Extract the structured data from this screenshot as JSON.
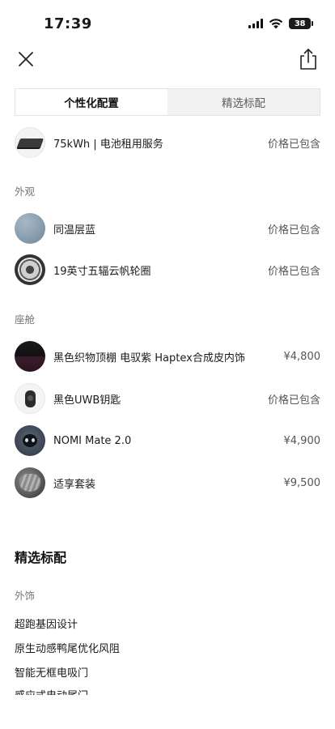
{
  "status_bar": {
    "time": "17:39",
    "battery": "38"
  },
  "tabs": [
    {
      "label": "个性化配置",
      "active": true
    },
    {
      "label": "精选标配",
      "active": false
    }
  ],
  "config_items": [
    {
      "label": "75kWh | 电池租用服务",
      "value": "价格已包含",
      "icon": "battery-pack-thumbnail"
    }
  ],
  "exterior": {
    "section_label": "外观",
    "items": [
      {
        "label": "同温层蓝",
        "value": "价格已包含",
        "icon": "paint-color-swatch"
      },
      {
        "label": "19英寸五辐云帆轮圈",
        "value": "价格已包含",
        "icon": "wheel-rim-thumbnail"
      }
    ]
  },
  "cabin": {
    "section_label": "座舱",
    "items": [
      {
        "label": "黑色织物顶棚 电驭紫 Haptex合成皮内饰",
        "value": "¥4,800",
        "icon": "interior-thumbnail"
      },
      {
        "label": "黑色UWB钥匙",
        "value": "价格已包含",
        "icon": "key-fob-thumbnail"
      },
      {
        "label": "NOMI Mate 2.0",
        "value": "¥4,900",
        "icon": "nomi-robot-thumbnail"
      },
      {
        "label": "适享套装",
        "value": "¥9,500",
        "icon": "seat-package-thumbnail"
      }
    ]
  },
  "standard": {
    "heading": "精选标配",
    "section_label": "外饰",
    "features": [
      "超跑基因设计",
      "原生动感鸭尾优化风阻",
      "智能无框电吸门",
      "感应式电动尾门"
    ]
  },
  "colors": {
    "text": "#1a1a1a",
    "muted": "#777777",
    "tab_bg": "#f2f2f2"
  }
}
